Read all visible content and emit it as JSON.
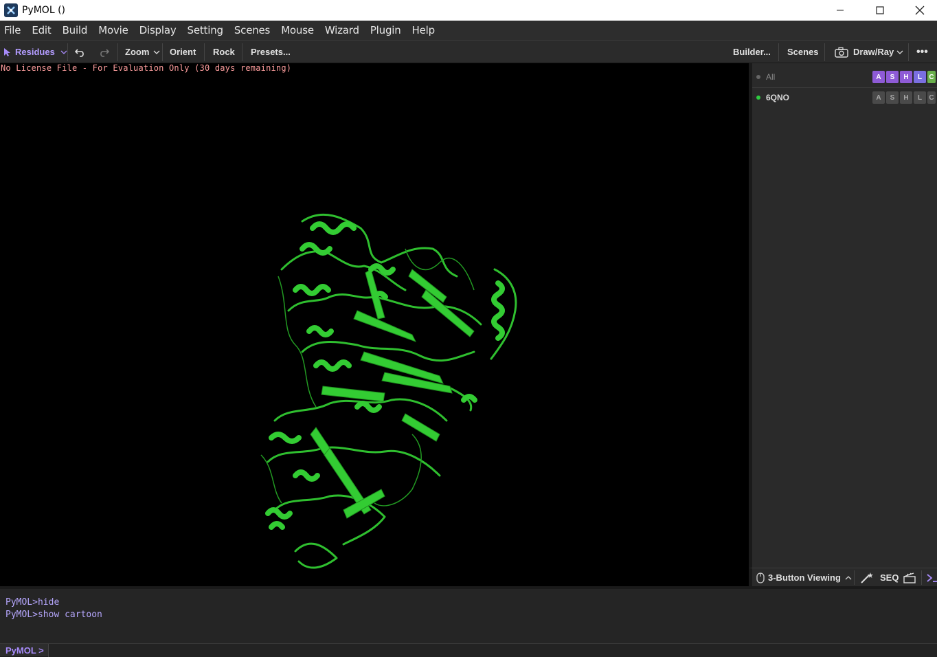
{
  "window": {
    "title": "PyMOL ()"
  },
  "menu": [
    "File",
    "Edit",
    "Build",
    "Movie",
    "Display",
    "Setting",
    "Scenes",
    "Mouse",
    "Wizard",
    "Plugin",
    "Help"
  ],
  "toolbar": {
    "selection_mode": "Residues",
    "zoom": "Zoom",
    "orient": "Orient",
    "rock": "Rock",
    "presets": "Presets...",
    "builder": "Builder...",
    "scenes": "Scenes",
    "draw_ray": "Draw/Ray",
    "more": "•••"
  },
  "viewport": {
    "license_text": "No License File - For Evaluation Only (30 days remaining)",
    "structure_color": "#33cc33",
    "background": "#000000"
  },
  "objects": [
    {
      "name": "All",
      "enabled": false,
      "buttons": [
        "A",
        "S",
        "H",
        "L",
        "C"
      ]
    },
    {
      "name": "6QNO",
      "enabled": true,
      "buttons": [
        "A",
        "S",
        "H",
        "L",
        "C"
      ]
    }
  ],
  "bottom_panel": {
    "mouse_mode": "3-Button Viewing",
    "seq": "SEQ"
  },
  "console": {
    "lines": [
      "PyMOL>hide",
      "PyMOL>show cartoon"
    ],
    "prompt": "PyMOL >"
  },
  "colors": {
    "accent": "#a78bfa",
    "A": "#8e5bd6",
    "S": "#8e5bd6",
    "H": "#8e5bd6",
    "L": "#7a6fe0",
    "C": "#6ab04c"
  }
}
